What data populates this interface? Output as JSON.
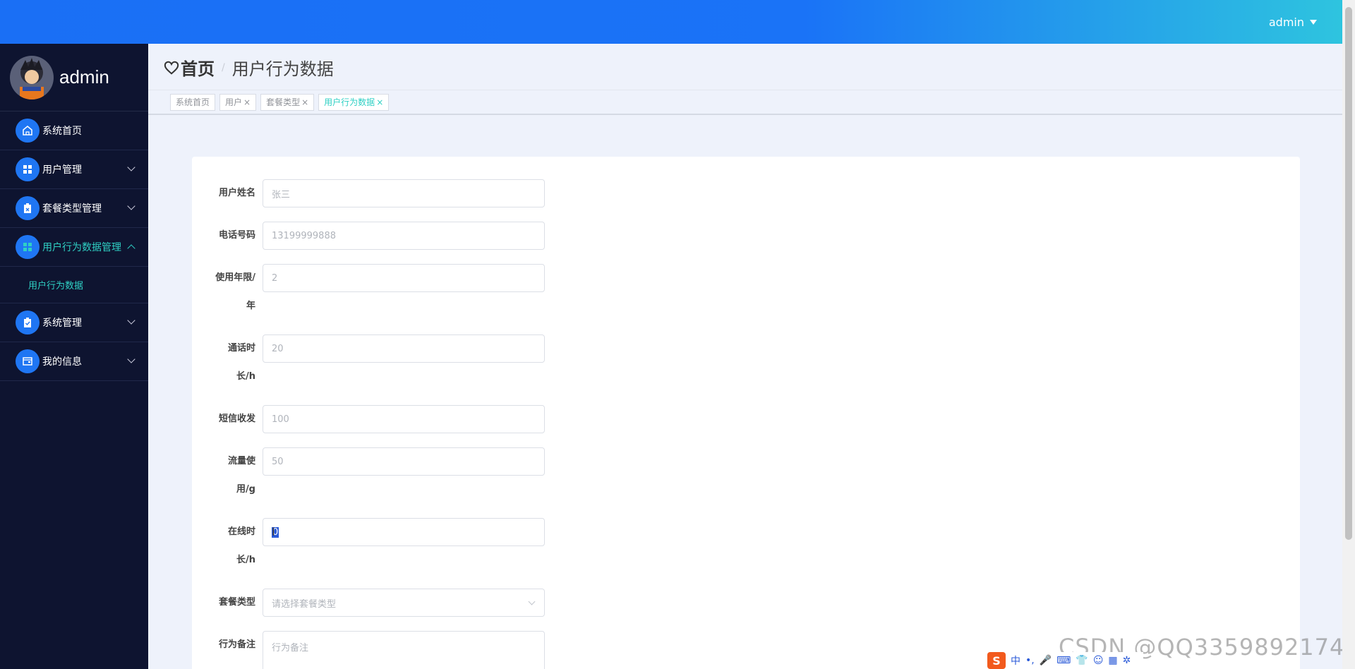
{
  "header": {
    "user_label": "admin"
  },
  "sidebar": {
    "profile_name": "admin",
    "items": [
      {
        "label": "系统首页",
        "icon": "home-icon"
      },
      {
        "label": "用户管理",
        "icon": "grid-icon"
      },
      {
        "label": "套餐类型管理",
        "icon": "clipboard-icon"
      },
      {
        "label": "用户行为数据管理",
        "icon": "grid-icon",
        "expanded": true
      },
      {
        "label": "系统管理",
        "icon": "clipboard-check-icon"
      },
      {
        "label": "我的信息",
        "icon": "wallet-icon"
      }
    ],
    "submenu": [
      {
        "label": "用户行为数据"
      }
    ]
  },
  "breadcrumb": {
    "home": "首页",
    "separator": "/",
    "current": "用户行为数据"
  },
  "tabs": [
    {
      "label": "系统首页",
      "closable": false
    },
    {
      "label": "用户",
      "closable": true
    },
    {
      "label": "套餐类型",
      "closable": true
    },
    {
      "label": "用户行为数据",
      "closable": true,
      "active": true
    }
  ],
  "tab_close_glyph": "×",
  "form": {
    "fields": [
      {
        "label": "用户姓名",
        "value": "张三"
      },
      {
        "label_line1": "电话号码",
        "value": "13199999888"
      },
      {
        "label_line1": "使用年限/",
        "label_line2": "年",
        "value": "2"
      },
      {
        "label_line1": "通话时",
        "label_line2": "长/h",
        "value": "20"
      },
      {
        "label_line1": "短信收发",
        "value": "100"
      },
      {
        "label_line1": "流量使",
        "label_line2": "用/g",
        "value": "50"
      },
      {
        "label_line1": "在线时",
        "label_line2": "长/h",
        "value": "0"
      },
      {
        "label_line1": "套餐类型",
        "placeholder": "请选择套餐类型"
      },
      {
        "label_line1": "行为备注",
        "placeholder": "行为备注"
      }
    ]
  },
  "ime": {
    "logo": "S",
    "mode": "中",
    "punct": "•,",
    "glyphs": [
      "🎤",
      "⌨",
      "👕",
      "☺",
      "▦",
      "✲"
    ]
  },
  "watermark": "CSDN @QQ3359892174",
  "colors": {
    "primary": "#1a6ff5",
    "accent": "#2fd0c4",
    "sidebar": "#0e1430"
  }
}
